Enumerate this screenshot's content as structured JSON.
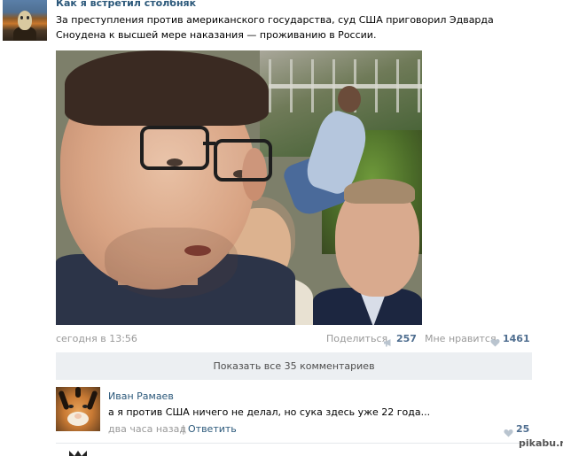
{
  "post": {
    "group_name": "Как я встретил столбняк",
    "text": "За преступления против американского государства, суд США приговорил Эдварда Сноудена к высшей мере наказания — проживанию в России.",
    "time": "сегодня в 13:56",
    "share_label": "Поделиться",
    "share_count": "257",
    "like_label": "Мне нравится",
    "like_count": "1461"
  },
  "comments": {
    "show_all_label": "Показать все 35 комментариев",
    "items": [
      {
        "author": "Иван Рамаев",
        "text": "а я против США ничего не делал, но сука здесь уже 22 года...",
        "time": "два часа назад",
        "separator": "|",
        "reply_label": "Ответить",
        "like_count": "25"
      }
    ]
  },
  "watermark": "pikabu.ru",
  "icons": {
    "share": "megaphone-icon",
    "like": "heart-icon"
  },
  "colors": {
    "link": "#2b587a",
    "count": "#4e6d8f",
    "muted": "#999999",
    "button_bg": "#eceff2"
  }
}
